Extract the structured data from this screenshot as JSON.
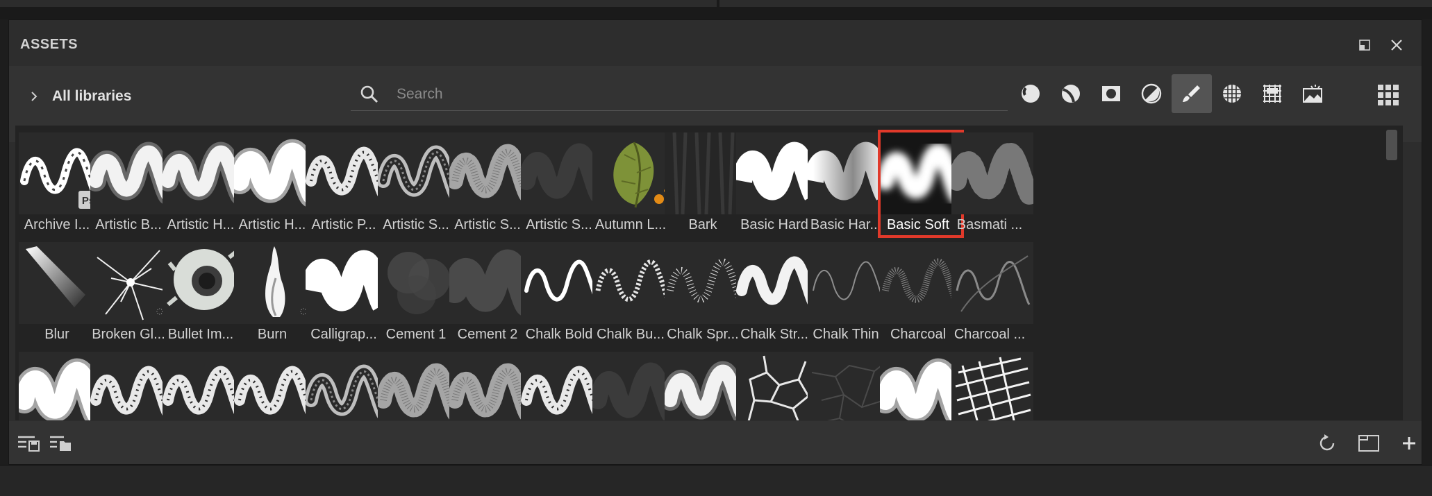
{
  "panel": {
    "title": "ASSETS"
  },
  "libraries": {
    "label": "All libraries"
  },
  "search": {
    "placeholder": "Search",
    "value": ""
  },
  "filters": [
    {
      "icon": "material-sphere-icon",
      "active": false
    },
    {
      "icon": "smart-material-icon",
      "active": false
    },
    {
      "icon": "smart-mask-icon",
      "active": false
    },
    {
      "icon": "filter-icon",
      "active": false
    },
    {
      "icon": "brush-icon",
      "active": true
    },
    {
      "icon": "alpha-icon",
      "active": false
    },
    {
      "icon": "texture-icon",
      "active": false
    },
    {
      "icon": "environment-icon",
      "active": false
    }
  ],
  "view_toggle": {
    "icon": "grid-view-icon"
  },
  "rows": [
    [
      {
        "name": "Archive I...",
        "thumb": "stroke-ps"
      },
      {
        "name": "Artistic B...",
        "thumb": "stroke-fluffy"
      },
      {
        "name": "Artistic H...",
        "thumb": "stroke-fluffy"
      },
      {
        "name": "Artistic H...",
        "thumb": "stroke-blob"
      },
      {
        "name": "Artistic P...",
        "thumb": "stroke-rough"
      },
      {
        "name": "Artistic S...",
        "thumb": "stroke-outline"
      },
      {
        "name": "Artistic S...",
        "thumb": "stroke-hatch"
      },
      {
        "name": "Artistic S...",
        "thumb": "stroke-faint"
      },
      {
        "name": "Autumn L...",
        "thumb": "leaf"
      },
      {
        "name": "Bark",
        "thumb": "bark"
      },
      {
        "name": "Basic Hard",
        "thumb": "stroke-hard"
      },
      {
        "name": "Basic Har...",
        "thumb": "stroke-gradient"
      },
      {
        "name": "Basic Soft",
        "thumb": "stroke-soft",
        "selected": true
      },
      {
        "name": "Basmati ...",
        "thumb": "speckle"
      }
    ],
    [
      {
        "name": "Blur",
        "thumb": "blur"
      },
      {
        "name": "Broken Gl...",
        "thumb": "glass"
      },
      {
        "name": "Bullet Im...",
        "thumb": "bullet"
      },
      {
        "name": "Burn",
        "thumb": "burn"
      },
      {
        "name": "Calligrap...",
        "thumb": "stroke-callig"
      },
      {
        "name": "Cement 1",
        "thumb": "cloud"
      },
      {
        "name": "Cement 2",
        "thumb": "cloud-stroke"
      },
      {
        "name": "Chalk Bold",
        "thumb": "line-bold"
      },
      {
        "name": "Chalk Bu...",
        "thumb": "line-dotted"
      },
      {
        "name": "Chalk Spr...",
        "thumb": "line-spray"
      },
      {
        "name": "Chalk Str...",
        "thumb": "stroke-chalk"
      },
      {
        "name": "Chalk Thin",
        "thumb": "line-thin"
      },
      {
        "name": "Charcoal",
        "thumb": "line-charcoal"
      },
      {
        "name": "Charcoal ...",
        "thumb": "line-charcoal2"
      }
    ],
    [
      {
        "name": "",
        "thumb": "stroke-blob"
      },
      {
        "name": "",
        "thumb": "stroke-rough"
      },
      {
        "name": "",
        "thumb": "stroke-rough"
      },
      {
        "name": "",
        "thumb": "stroke-rough"
      },
      {
        "name": "",
        "thumb": "stroke-outline"
      },
      {
        "name": "",
        "thumb": "stroke-hatch"
      },
      {
        "name": "",
        "thumb": "stroke-hatch"
      },
      {
        "name": "",
        "thumb": "stroke-rough"
      },
      {
        "name": "",
        "thumb": "stroke-faint"
      },
      {
        "name": "",
        "thumb": "stroke-fluffy"
      },
      {
        "name": "",
        "thumb": "cells"
      },
      {
        "name": "",
        "thumb": "cracks"
      },
      {
        "name": "",
        "thumb": "stroke-blob"
      },
      {
        "name": "",
        "thumb": "hatch-block"
      }
    ]
  ],
  "footer": {
    "left": [
      "export-library-icon",
      "import-folder-icon"
    ],
    "right": [
      "refresh-icon",
      "new-folder-icon",
      "add-icon"
    ]
  }
}
